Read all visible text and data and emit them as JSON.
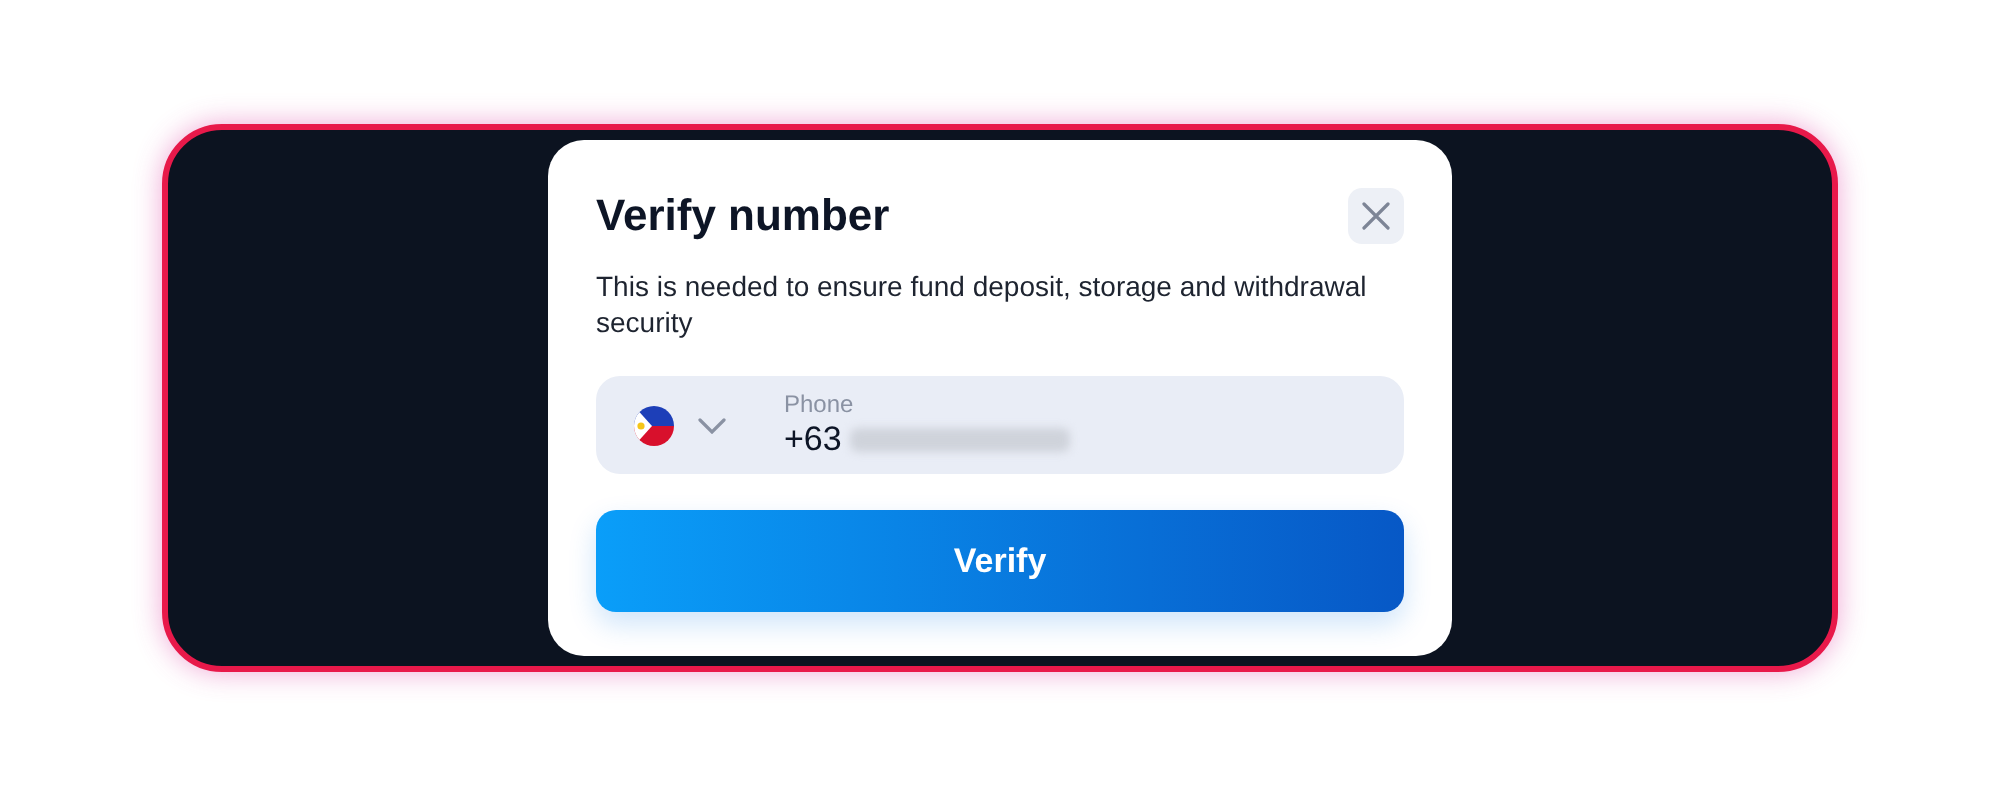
{
  "dialog": {
    "title": "Verify number",
    "description": "This is needed to ensure fund deposit, storage and withdrawal security",
    "phone_field": {
      "label": "Phone",
      "value": "+63"
    },
    "button": "Verify"
  }
}
